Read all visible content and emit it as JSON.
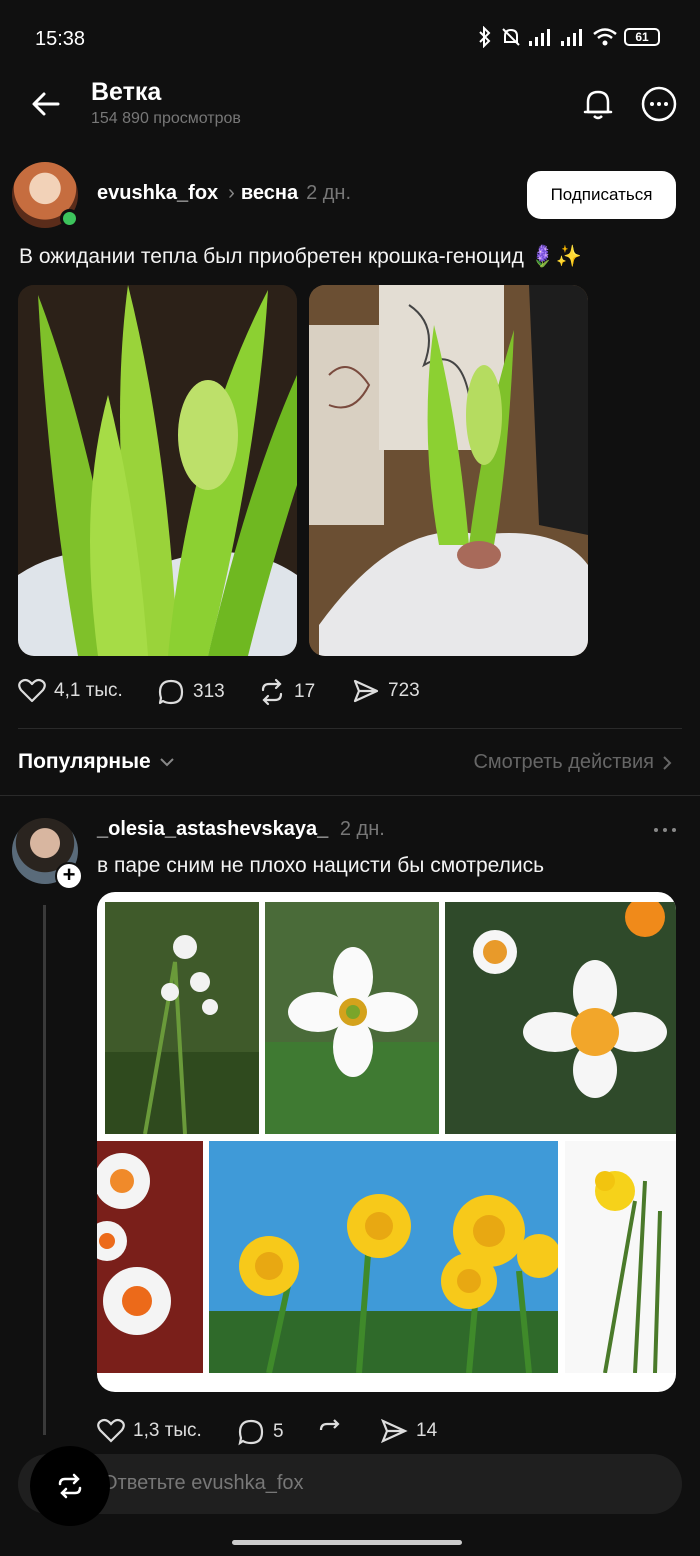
{
  "status_bar": {
    "time": "15:38",
    "battery": "61"
  },
  "header": {
    "title": "Ветка",
    "subtitle": "154 890 просмотров"
  },
  "post": {
    "author": "evushka_fox",
    "topic": "весна",
    "time": "2 дн.",
    "subscribe_label": "Подписаться",
    "text": "В ожидании тепла был приобретен крошка-геноцид 🪻✨",
    "likes": "4,1 тыс.",
    "comments": "313",
    "reposts": "17",
    "shares": "723"
  },
  "sort": {
    "label": "Популярные",
    "view_actions": "Смотреть действия"
  },
  "reply": {
    "author": "_olesia_astashevskaya_",
    "time": "2 дн.",
    "text": "в паре сним не плохо нацисти бы смотрелись",
    "likes": "1,3 тыс.",
    "comments": "5",
    "shares": "14"
  },
  "composer": {
    "placeholder": "Ответьте evushka_fox"
  },
  "colors": {
    "background": "#101010",
    "online": "#3dc45c",
    "muted": "#777777"
  }
}
